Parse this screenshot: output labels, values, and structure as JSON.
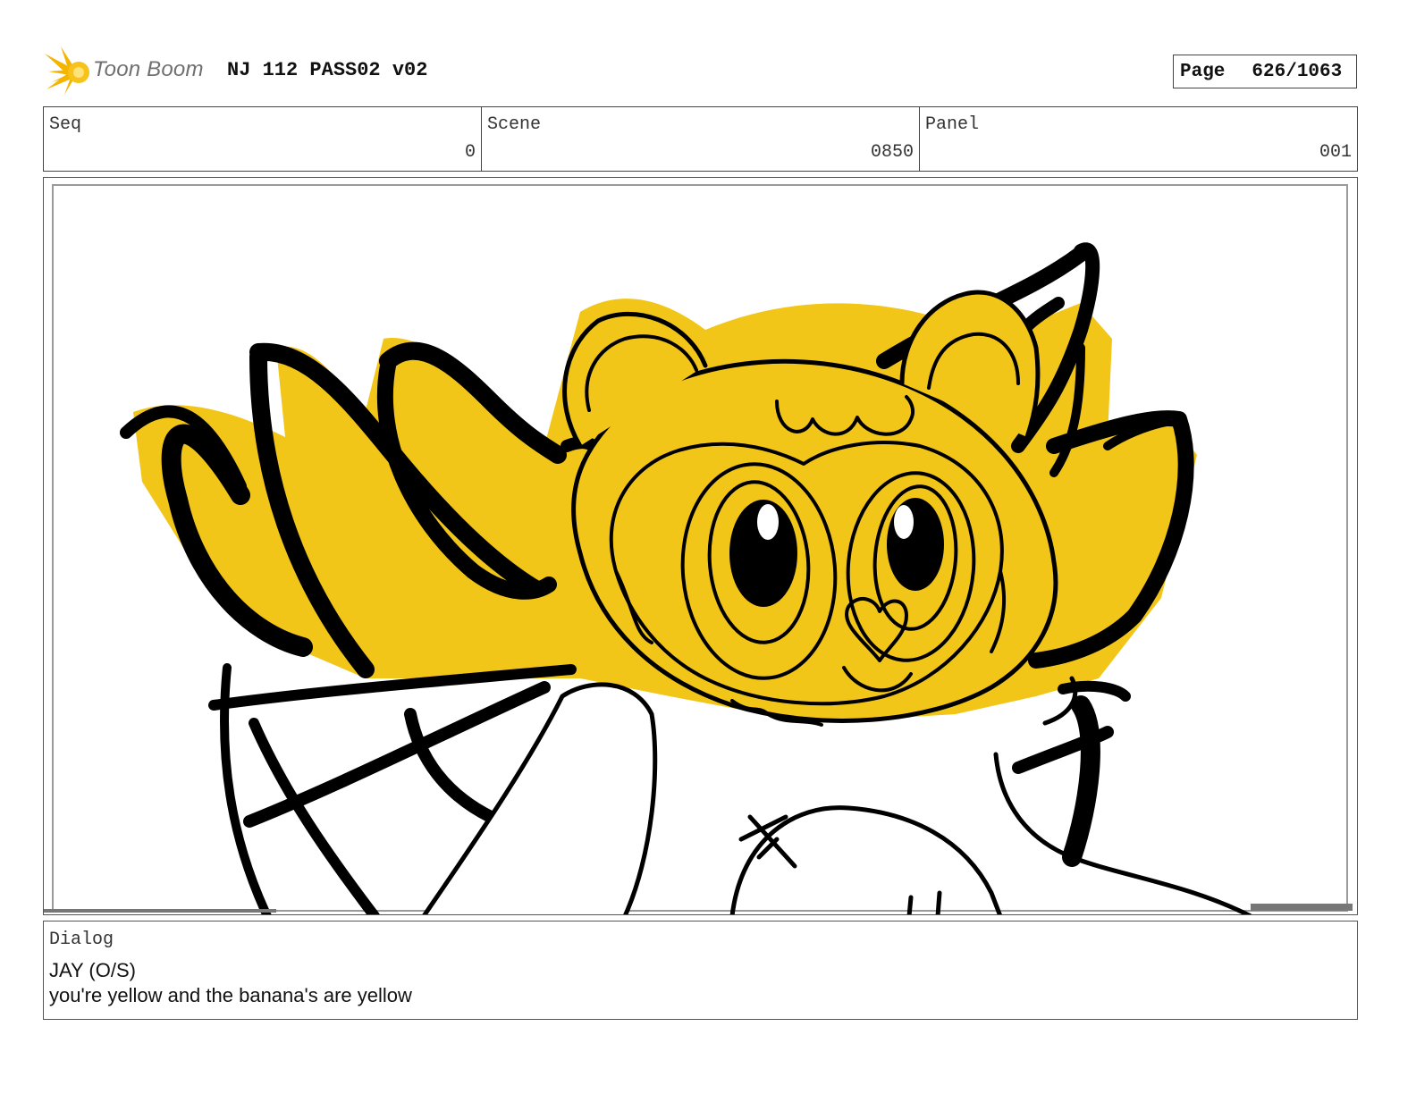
{
  "header": {
    "logo_text": "Toon Boom",
    "doc_title": "NJ 112 PASS02 v02",
    "page_label": "Page",
    "page_value": "626/1063"
  },
  "info": {
    "seq_label": "Seq",
    "seq_value": "0",
    "scene_label": "Scene",
    "scene_value": "0850",
    "panel_label": "Panel",
    "panel_value": "001"
  },
  "dialog": {
    "label": "Dialog",
    "speaker": "JAY (O/S)",
    "line": "you're yellow and the banana's are yellow"
  },
  "colors": {
    "accent_yellow": "#f2c618",
    "ink": "#000000",
    "logo_orange": "#f5b400"
  },
  "icons": {
    "logo": "toon-boom-sunburst-icon"
  }
}
